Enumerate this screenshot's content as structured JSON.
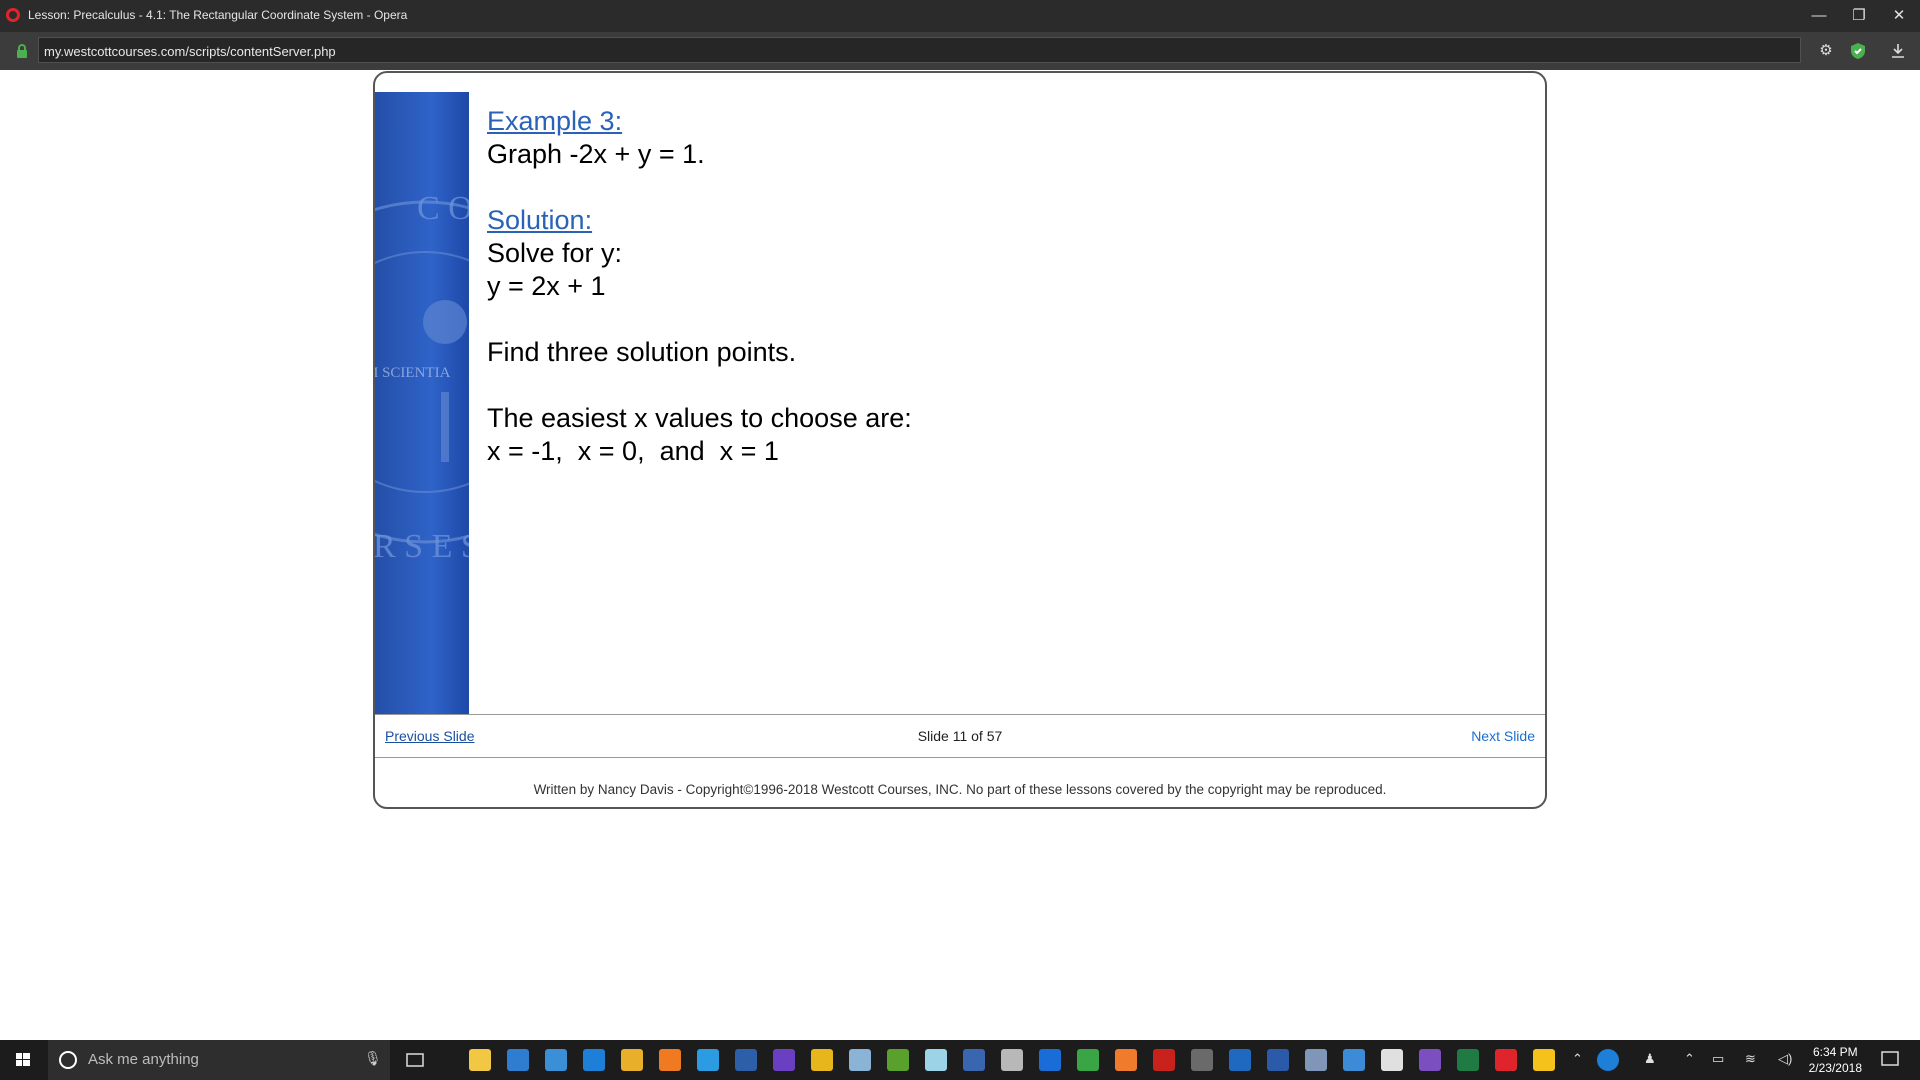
{
  "window": {
    "title": "Lesson: Precalculus - 4.1: The Rectangular Coordinate System - Opera",
    "minimize": "—",
    "restore": "❐",
    "close": "✕"
  },
  "address": {
    "url": "my.westcottcourses.com/scripts/contentServer.php"
  },
  "toolbar": {
    "settings_icon": "gear-icon",
    "vpn_icon": "shield-icon",
    "download_icon": "download-icon"
  },
  "slide": {
    "example_label": "Example 3:",
    "problem": "Graph -2x + y = 1.",
    "solution_label": "Solution:",
    "step1": "Solve for y:",
    "step2": "y = 2x + 1",
    "step3": "Find three solution points.",
    "step4": "The easiest x values to choose are:",
    "step5": "x = -1,  x = 0,  and  x = 1",
    "seal_top": "C O",
    "seal_mid": "M SCIENTIA",
    "seal_bottom": "R S E S"
  },
  "nav": {
    "previous": "Previous Slide",
    "counter": "Slide 11 of 57",
    "next": "Next Slide"
  },
  "footer": {
    "copyright": "Written by Nancy Davis - Copyright©1996-2018 Westcott Courses, INC. No part of these lessons covered by the copyright may be reproduced."
  },
  "taskbar": {
    "search_placeholder": "Ask me anything",
    "time": "6:34 PM",
    "date": "2/23/2018",
    "pinned": [
      {
        "name": "file-explorer-icon",
        "color": "#f2c744"
      },
      {
        "name": "store-icon",
        "color": "#2f7dd1"
      },
      {
        "name": "visual-studio-code-icon",
        "color": "#3a8fd6"
      },
      {
        "name": "edge-icon",
        "color": "#1e7fd8"
      },
      {
        "name": "chrome-icon",
        "color": "#e8b02a"
      },
      {
        "name": "firefox-icon",
        "color": "#f07a22"
      },
      {
        "name": "ie-icon",
        "color": "#2b9be2"
      },
      {
        "name": "powershell-icon",
        "color": "#2d5fa8"
      },
      {
        "name": "dp-app-icon",
        "color": "#6b3fc2"
      },
      {
        "name": "star-app-icon",
        "color": "#e7b51c"
      },
      {
        "name": "paint-app-icon",
        "color": "#8ab3d6"
      },
      {
        "name": "lambda-app-icon",
        "color": "#5aa02c"
      },
      {
        "name": "notes-app-icon",
        "color": "#9dd3e6"
      },
      {
        "name": "media-app-icon",
        "color": "#3a66b0"
      },
      {
        "name": "calculator-icon",
        "color": "#b8b8b8"
      },
      {
        "name": "teamviewer-icon",
        "color": "#1a6dd6"
      },
      {
        "name": "camtasia-icon",
        "color": "#3aa544"
      },
      {
        "name": "xampp-icon",
        "color": "#f07b2d"
      },
      {
        "name": "filezilla-icon",
        "color": "#c9221d"
      },
      {
        "name": "sublime-icon",
        "color": "#6a6a6a"
      },
      {
        "name": "outlook-icon",
        "color": "#1f6ac0"
      },
      {
        "name": "word-icon",
        "color": "#2b5aa8"
      },
      {
        "name": "network-app-icon",
        "color": "#7f96b8"
      },
      {
        "name": "remote-desktop-icon",
        "color": "#3d8bd6"
      },
      {
        "name": "mail-icon",
        "color": "#e0e0e0"
      },
      {
        "name": "visual-studio-icon",
        "color": "#7b4fc0"
      },
      {
        "name": "excel-icon",
        "color": "#1f7a43"
      },
      {
        "name": "opera-icon",
        "color": "#e0242b"
      },
      {
        "name": "presentation-app-icon",
        "color": "#f4c21a"
      }
    ]
  }
}
